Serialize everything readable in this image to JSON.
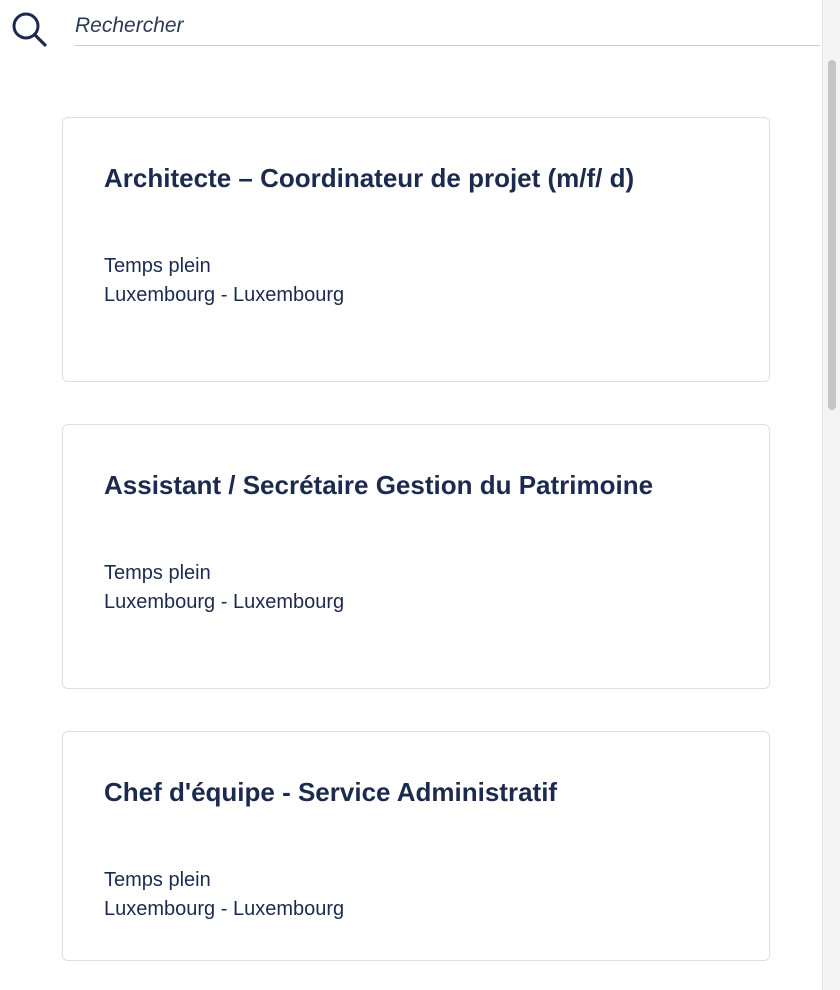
{
  "search": {
    "placeholder": "Rechercher",
    "icon": "search-icon"
  },
  "jobs": [
    {
      "title": "Architecte – Coordinateur de projet (m/f/ d)",
      "type": "Temps plein",
      "location": "Luxembourg - Luxembourg"
    },
    {
      "title": "Assistant / Secrétaire Gestion du Patrimoine",
      "type": "Temps plein",
      "location": "Luxembourg - Luxembourg"
    },
    {
      "title": "Chef d'équipe - Service Administratif",
      "type": "Temps plein",
      "location": "Luxembourg - Luxembourg"
    }
  ],
  "colors": {
    "text": "#1b2a4e",
    "border": "#dcdee3",
    "background": "#ffffff"
  }
}
